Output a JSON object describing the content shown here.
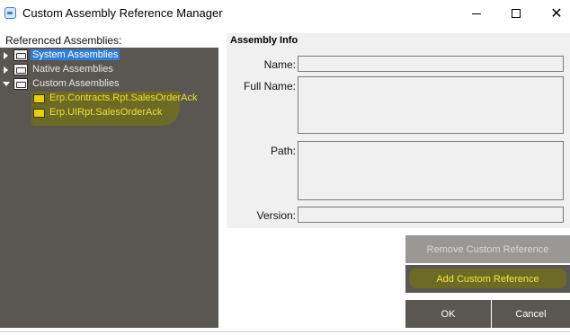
{
  "window": {
    "title": "Custom Assembly Reference Manager",
    "minimize_icon": "minimize-icon",
    "maximize_icon": "maximize-icon",
    "close_icon": "close-icon",
    "close_glyph": "✕"
  },
  "left_panel": {
    "label": "Referenced Assemblies:",
    "tree": [
      {
        "label": "System Assemblies",
        "expanded": false,
        "selected": true
      },
      {
        "label": "Native Assemblies",
        "expanded": false,
        "selected": false
      },
      {
        "label": "Custom Assemblies",
        "expanded": true,
        "selected": false,
        "children": [
          {
            "label": "Erp.Contracts.Rpt.SalesOrderAck"
          },
          {
            "label": "Erp.UIRpt.SalesOrderAck"
          }
        ]
      }
    ]
  },
  "assembly_info": {
    "title": "Assembly Info",
    "name_label": "Name:",
    "name_value": "",
    "full_name_label": "Full Name:",
    "full_name_value": "",
    "path_label": "Path:",
    "path_value": "",
    "version_label": "Version:",
    "version_value": ""
  },
  "buttons": {
    "remove": "Remove Custom Reference",
    "add": "Add Custom Reference",
    "ok": "OK",
    "cancel": "Cancel"
  },
  "colors": {
    "tree_bg": "#5a5753",
    "selected_bg": "#2f7dd6",
    "highlight": "#e9e22a"
  }
}
